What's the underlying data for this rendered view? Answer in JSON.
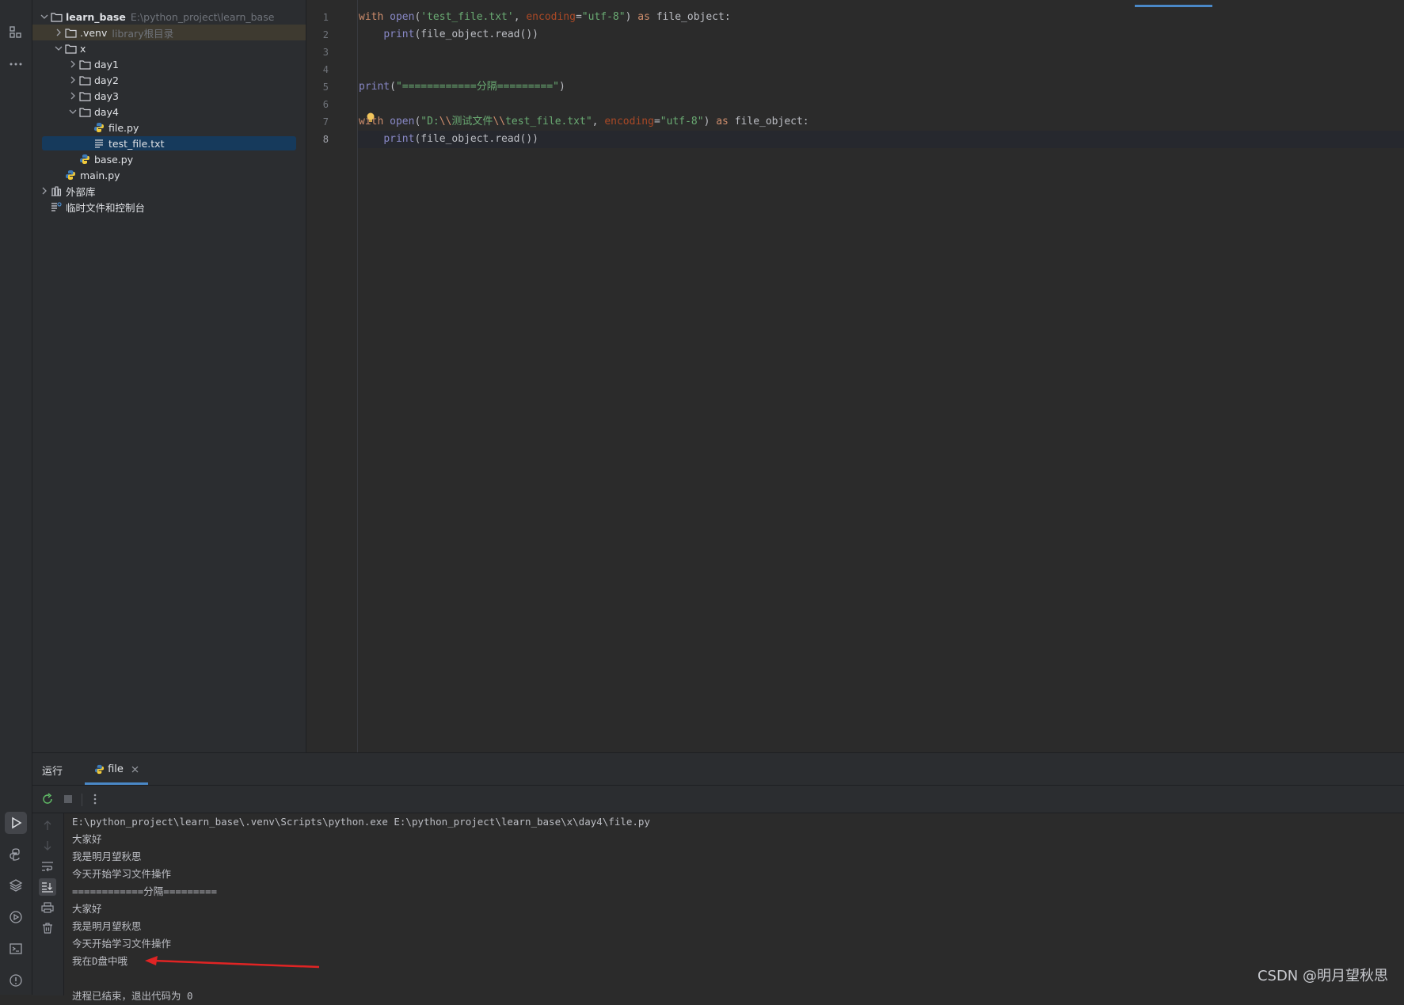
{
  "project_tree": {
    "root": {
      "label": "learn_base",
      "path": "E:\\python_project\\learn_base"
    },
    "venv": {
      "label": ".venv",
      "hint": "library根目录"
    },
    "x": {
      "label": "x"
    },
    "day1": {
      "label": "day1"
    },
    "day2": {
      "label": "day2"
    },
    "day3": {
      "label": "day3"
    },
    "day4": {
      "label": "day4"
    },
    "file_py": {
      "label": "file.py"
    },
    "test_file": {
      "label": "test_file.txt"
    },
    "base_py": {
      "label": "base.py"
    },
    "main_py": {
      "label": "main.py"
    },
    "ext_libs": {
      "label": "外部库"
    },
    "scratches": {
      "label": "临时文件和控制台"
    }
  },
  "editor": {
    "line_numbers": [
      "1",
      "2",
      "3",
      "4",
      "5",
      "6",
      "7",
      "8"
    ],
    "line1": {
      "t1": "with",
      "t2": " ",
      "t3": "open",
      "t4": "(",
      "t5": "'test_file.txt'",
      "t6": ", ",
      "t7": "encoding",
      "t8": "=",
      "t9": "\"utf-8\"",
      "t10": ") ",
      "t11": "as",
      "t12": " file_object:"
    },
    "line2": {
      "t1": "    ",
      "t2": "print",
      "t3": "(file_object.read())"
    },
    "line5": {
      "t1": "print",
      "t2": "(",
      "t3": "\"============分隔=========\"",
      "t4": ")"
    },
    "line7": {
      "t1": "with",
      "t2": " ",
      "t3": "open",
      "t4": "(",
      "t5": "\"D:",
      "t6": "\\\\",
      "t7": "测试文件",
      "t8": "\\\\",
      "t9": "test_file.txt\"",
      "t10": ", ",
      "t11": "encoding",
      "t12": "=",
      "t13": "\"utf-8\"",
      "t14": ") ",
      "t15": "as",
      "t16": " file_object:"
    },
    "line8": {
      "t1": "    ",
      "t2": "print",
      "t3": "(file_object.read())"
    }
  },
  "run_panel": {
    "title": "运行",
    "tab_label": "file",
    "output": [
      "E:\\python_project\\learn_base\\.venv\\Scripts\\python.exe E:\\python_project\\learn_base\\x\\day4\\file.py",
      "大家好",
      "我是明月望秋思",
      "今天开始学习文件操作",
      "============分隔=========",
      "大家好",
      "我是明月望秋思",
      "今天开始学习文件操作",
      "我在D盘中哦",
      "",
      "进程已结束，退出代码为 0"
    ]
  },
  "watermark": "CSDN @明月望秋思",
  "colors": {
    "accent": "#4a88c7",
    "annotation_arrow": "#e02424",
    "selection": "#163a5c"
  }
}
